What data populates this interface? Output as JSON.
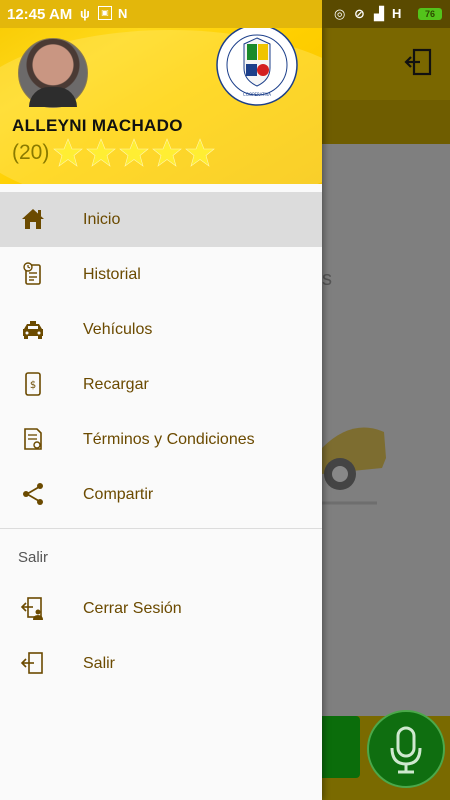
{
  "status_bar": {
    "time": "12:45 AM",
    "network": "H",
    "battery": "76"
  },
  "drawer": {
    "user_name": "ALLEYNI MACHADO",
    "rating_count": "(20)",
    "stars": 5,
    "menu": [
      {
        "label": "Inicio",
        "icon": "home-icon",
        "active": true
      },
      {
        "label": "Historial",
        "icon": "history-icon"
      },
      {
        "label": "Vehículos",
        "icon": "taxi-icon"
      },
      {
        "label": "Recargar",
        "icon": "recharge-icon"
      },
      {
        "label": "Términos y Condiciones",
        "icon": "terms-icon"
      },
      {
        "label": "Compartir",
        "icon": "share-icon"
      }
    ],
    "section_title": "Salir",
    "section_menu": [
      {
        "label": "Cerrar Sesión",
        "icon": "logout-session-icon"
      },
      {
        "label": "Salir",
        "icon": "exit-icon"
      }
    ]
  },
  "background_app": {
    "partial_text": "s"
  },
  "colors": {
    "header_yellow": "#ffd200",
    "menu_text": "#6b4a00",
    "icon": "#6b4a00",
    "star": "#ffee33"
  }
}
